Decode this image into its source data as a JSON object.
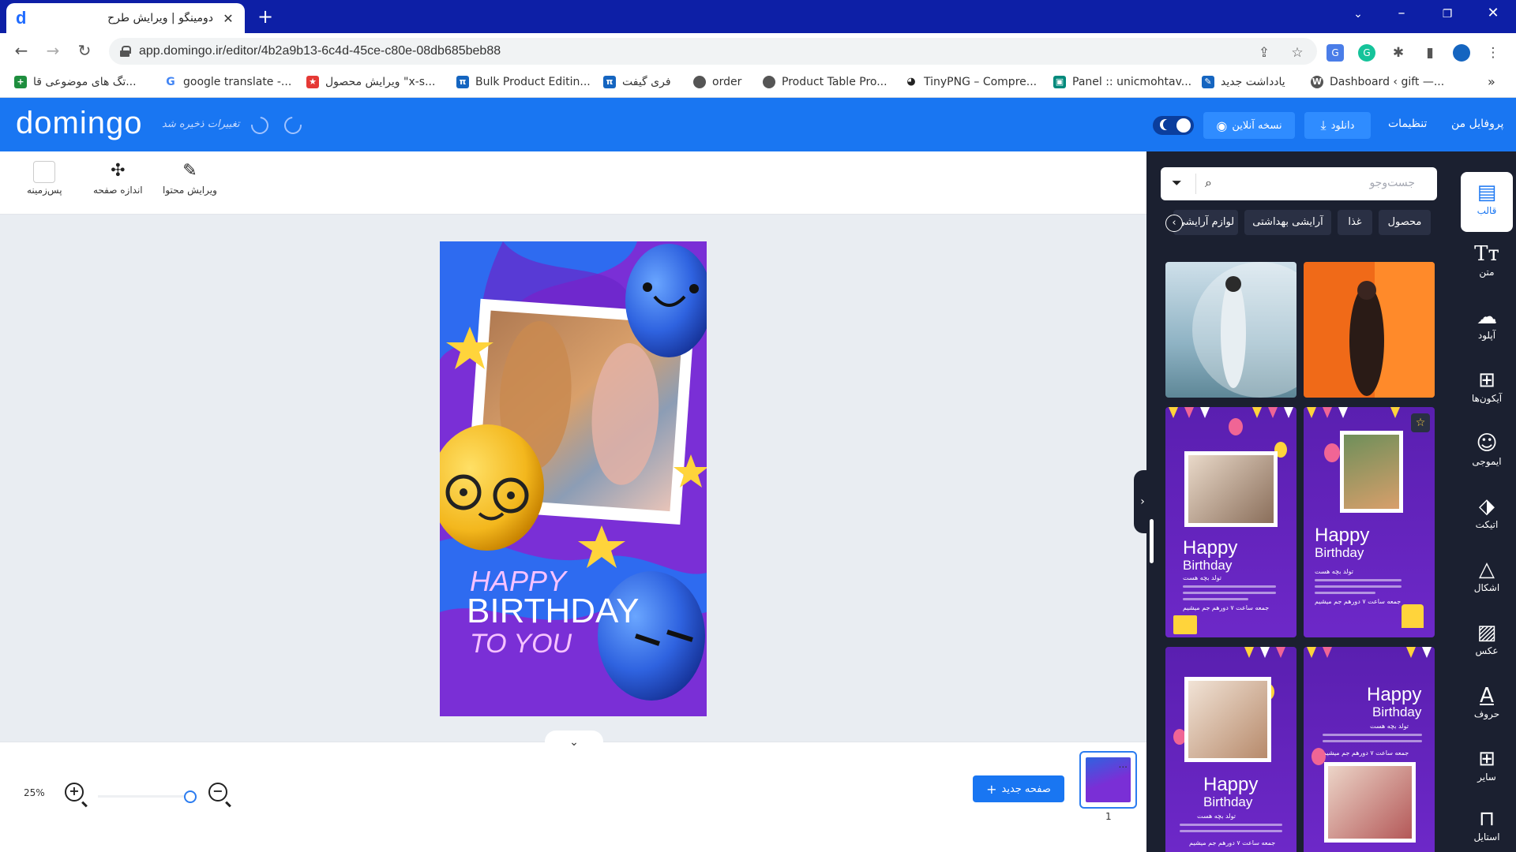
{
  "browser": {
    "tab_title": "دومینگو | ویرایش طرح",
    "tab_icon": "d",
    "url": "app.domingo.ir/editor/4b2a9b13-6c4d-45ce-c80e-08db685beb88",
    "bookmarks": [
      {
        "label": "تگ های موضوعی قا...",
        "icon": "sheets-icon",
        "color": "#1e8e3e"
      },
      {
        "label": "google translate -...",
        "icon": "google-icon",
        "color": "#4285f4"
      },
      {
        "label": "ویرایش محصول \"x-s...",
        "icon": "star-bookmark-icon",
        "color": "#e53935"
      },
      {
        "label": "Bulk Product Editin...",
        "icon": "product-icon",
        "color": "#1565c0"
      },
      {
        "label": "فری گیفت",
        "icon": "product-icon",
        "color": "#1565c0"
      },
      {
        "label": "order",
        "icon": "globe-icon",
        "color": "#444"
      },
      {
        "label": "Product Table Pro...",
        "icon": "globe-icon",
        "color": "#444"
      },
      {
        "label": "TinyPNG – Compre...",
        "icon": "panda-icon",
        "color": "#444"
      },
      {
        "label": "Panel :: unicmohtav...",
        "icon": "panel-icon",
        "color": "#00897b"
      },
      {
        "label": "یادداشت جدید",
        "icon": "note-icon",
        "color": "#1565c0"
      },
      {
        "label": "Dashboard ‹ gift —...",
        "icon": "wordpress-icon",
        "color": "#444"
      }
    ],
    "more_bookmarks": "»"
  },
  "app": {
    "logo": "domingo",
    "save_status": "تغییرات ذخیره شد",
    "nav": {
      "profile": "پروفایل من",
      "settings": "تنظیمات",
      "download": "دانلود",
      "online": "نسخه آنلاین"
    },
    "colors": {
      "header": "#1976f2",
      "panel": "#1b2030",
      "accent": "#1976f2"
    }
  },
  "toolbar": {
    "edit_content": "ویرایش محتوا",
    "page_size": "اندازه صفحه",
    "background": "پس‌زمینه"
  },
  "design": {
    "line1": "HAPPY",
    "line2": "BIRTHDAY",
    "line3": "TO YOU"
  },
  "bottom": {
    "zoom": "25%",
    "zoom_level": 0.25,
    "new_page": "صفحه جدید",
    "page_number": "1",
    "thumb_menu": "..."
  },
  "panel": {
    "search_placeholder": "جست‌وجو",
    "chips": [
      "محصول",
      "غذا",
      "آرایشی بهداشتی",
      "لوازم آرایشی"
    ],
    "templates": [
      {
        "hb": "Happy",
        "hb2": "Birthday",
        "sub": "تولد بچه هست",
        "when": "جمعه ساعت ۷ دورهم جم میشیم"
      },
      {
        "hb": "Happy",
        "hb2": "Birthday",
        "sub": "تولد بچه هست",
        "when": "جمعه ساعت ۷ دورهم جم میشیم"
      },
      {
        "hb": "Happy",
        "hb2": "Birthday",
        "sub": "تولد بچه هست",
        "when": "جمعه ساعت ۷ دورهم جم میشیم"
      },
      {
        "hb": "Happy",
        "hb2": "Birthday",
        "sub": "تولد بچه هست",
        "when": "جمعه ساعت ۷ دورهم جم میشیم"
      }
    ]
  },
  "sidebar": {
    "items": [
      {
        "label": "قالب",
        "icon": "template-icon"
      },
      {
        "label": "متن",
        "icon": "text-icon"
      },
      {
        "label": "آپلود",
        "icon": "upload-icon"
      },
      {
        "label": "آیکون‌ها",
        "icon": "icons-grid-icon"
      },
      {
        "label": "ایموجی",
        "icon": "emoji-icon"
      },
      {
        "label": "اتیکت",
        "icon": "tag-icon"
      },
      {
        "label": "اشکال",
        "icon": "shapes-icon"
      },
      {
        "label": "عکس",
        "icon": "image-icon"
      },
      {
        "label": "حروف",
        "icon": "letters-icon"
      },
      {
        "label": "سایر",
        "icon": "more-icon"
      },
      {
        "label": "استایل",
        "icon": "style-icon"
      }
    ]
  }
}
